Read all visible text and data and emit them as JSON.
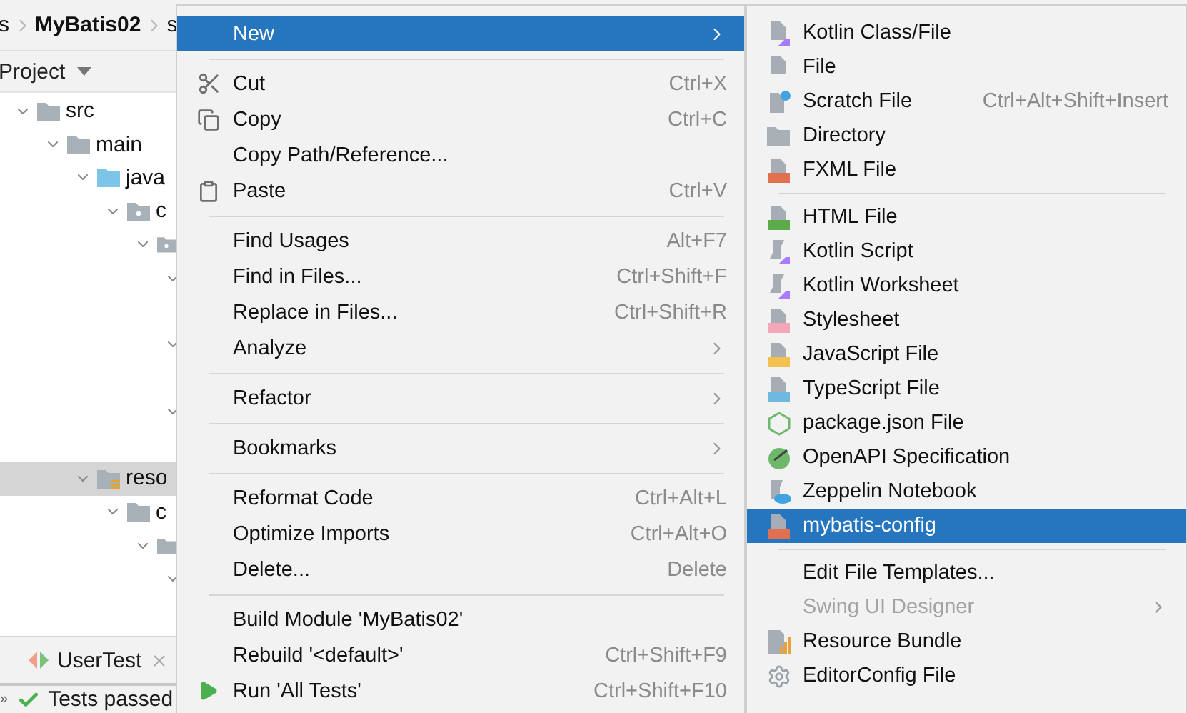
{
  "breadcrumb": [
    "s",
    "MyBatis02",
    "s"
  ],
  "project_view": {
    "title": "Project"
  },
  "tree": [
    {
      "kind": "folder",
      "label": "src",
      "expanded": true,
      "selected": false,
      "children": [
        {
          "kind": "folder",
          "label": "main",
          "expanded": true,
          "selected": false,
          "children": [
            {
              "kind": "source",
              "label": "java",
              "expanded": true,
              "selected": false,
              "children": [
                {
                  "kind": "package",
                  "label": "c",
                  "expanded": true,
                  "selected": false,
                  "children": [
                    {
                      "kind": "package",
                      "expanded": true,
                      "selected": false,
                      "children": [
                        {
                          "expanded": true,
                          "selected": false
                        },
                        {
                          "expanded": true,
                          "selected": false
                        },
                        {
                          "expanded": true,
                          "selected": false
                        }
                      ]
                    }
                  ]
                }
              ]
            },
            {
              "kind": "resources",
              "label": "reso",
              "expanded": true,
              "selected": true,
              "children": [
                {
                  "kind": "folder",
                  "label": "c",
                  "expanded": true,
                  "selected": false,
                  "children": [
                    {
                      "kind": "folder",
                      "expanded": true,
                      "selected": false,
                      "children": [
                        {
                          "expanded": true,
                          "selected": false
                        }
                      ]
                    }
                  ]
                }
              ]
            }
          ]
        }
      ]
    }
  ],
  "run_panel": {
    "tab": "UserTest",
    "more": "»",
    "status": "Tests passed"
  },
  "context_menu": [
    {
      "kind": "plain",
      "label": "New",
      "submenu": true,
      "selected": true
    },
    {
      "kind": "separator"
    },
    {
      "kind": "cut",
      "label": "Cut",
      "shortcut": "Ctrl+X",
      "submenu": false,
      "selected": false
    },
    {
      "kind": "copy",
      "label": "Copy",
      "shortcut": "Ctrl+C",
      "submenu": false,
      "selected": false
    },
    {
      "kind": "plain",
      "label": "Copy Path/Reference...",
      "submenu": false,
      "selected": false
    },
    {
      "kind": "paste",
      "label": "Paste",
      "shortcut": "Ctrl+V",
      "submenu": false,
      "selected": false
    },
    {
      "kind": "separator"
    },
    {
      "kind": "plain",
      "label": "Find Usages",
      "shortcut": "Alt+F7",
      "submenu": false,
      "selected": false
    },
    {
      "kind": "plain",
      "label": "Find in Files...",
      "shortcut": "Ctrl+Shift+F",
      "submenu": false,
      "selected": false
    },
    {
      "kind": "plain",
      "label": "Replace in Files...",
      "shortcut": "Ctrl+Shift+R",
      "submenu": false,
      "selected": false
    },
    {
      "kind": "plain",
      "label": "Analyze",
      "submenu": true,
      "selected": false
    },
    {
      "kind": "separator"
    },
    {
      "kind": "plain",
      "label": "Refactor",
      "submenu": true,
      "selected": false
    },
    {
      "kind": "separator"
    },
    {
      "kind": "plain",
      "label": "Bookmarks",
      "submenu": true,
      "selected": false
    },
    {
      "kind": "separator"
    },
    {
      "kind": "plain",
      "label": "Reformat Code",
      "shortcut": "Ctrl+Alt+L",
      "submenu": false,
      "selected": false
    },
    {
      "kind": "plain",
      "label": "Optimize Imports",
      "shortcut": "Ctrl+Alt+O",
      "submenu": false,
      "selected": false
    },
    {
      "kind": "plain",
      "label": "Delete...",
      "shortcut": "Delete",
      "submenu": false,
      "selected": false
    },
    {
      "kind": "separator"
    },
    {
      "kind": "plain",
      "label": "Build Module 'MyBatis02'",
      "submenu": false,
      "selected": false
    },
    {
      "kind": "plain",
      "label": "Rebuild '<default>'",
      "shortcut": "Ctrl+Shift+F9",
      "submenu": false,
      "selected": false
    },
    {
      "kind": "run",
      "label": "Run 'All Tests'",
      "shortcut": "Ctrl+Shift+F10",
      "submenu": false,
      "selected": false
    }
  ],
  "new_submenu": [
    {
      "kind": "kotlin",
      "label": "Kotlin Class/File",
      "submenu": false,
      "selected": false,
      "disabled": false
    },
    {
      "kind": "file",
      "label": "File",
      "submenu": false,
      "selected": false,
      "disabled": false
    },
    {
      "kind": "scratch",
      "label": "Scratch File",
      "shortcut": "Ctrl+Alt+Shift+Insert",
      "submenu": false,
      "selected": false,
      "disabled": false
    },
    {
      "kind": "folder",
      "label": "Directory",
      "submenu": false,
      "selected": false,
      "disabled": false
    },
    {
      "kind": "xml",
      "label": "FXML File",
      "submenu": false,
      "selected": false,
      "disabled": false
    },
    {
      "kind": "separator"
    },
    {
      "kind": "html",
      "label": "HTML File",
      "submenu": false,
      "selected": false,
      "disabled": false
    },
    {
      "kind": "kotlin-script",
      "label": "Kotlin Script",
      "submenu": false,
      "selected": false,
      "disabled": false
    },
    {
      "kind": "kotlin-script",
      "label": "Kotlin Worksheet",
      "submenu": false,
      "selected": false,
      "disabled": false
    },
    {
      "kind": "css",
      "label": "Stylesheet",
      "submenu": false,
      "selected": false,
      "disabled": false
    },
    {
      "kind": "js",
      "label": "JavaScript File",
      "submenu": false,
      "selected": false,
      "disabled": false
    },
    {
      "kind": "ts",
      "label": "TypeScript File",
      "submenu": false,
      "selected": false,
      "disabled": false
    },
    {
      "kind": "npm",
      "label": "package.json File",
      "submenu": false,
      "selected": false,
      "disabled": false
    },
    {
      "kind": "openapi",
      "label": "OpenAPI Specification",
      "submenu": false,
      "selected": false,
      "disabled": false
    },
    {
      "kind": "zeppelin",
      "label": "Zeppelin Notebook",
      "submenu": false,
      "selected": false,
      "disabled": false
    },
    {
      "kind": "xml",
      "label": "mybatis-config",
      "submenu": false,
      "selected": true,
      "disabled": false
    },
    {
      "kind": "separator"
    },
    {
      "kind": "plain",
      "label": "Edit File Templates...",
      "submenu": false,
      "selected": false,
      "disabled": false
    },
    {
      "kind": "plain",
      "label": "Swing UI Designer",
      "submenu": true,
      "selected": false,
      "disabled": true
    },
    {
      "kind": "bundle",
      "label": "Resource Bundle",
      "submenu": false,
      "selected": false,
      "disabled": false
    },
    {
      "kind": "gear",
      "label": "EditorConfig File",
      "submenu": false,
      "selected": false,
      "disabled": false
    }
  ]
}
